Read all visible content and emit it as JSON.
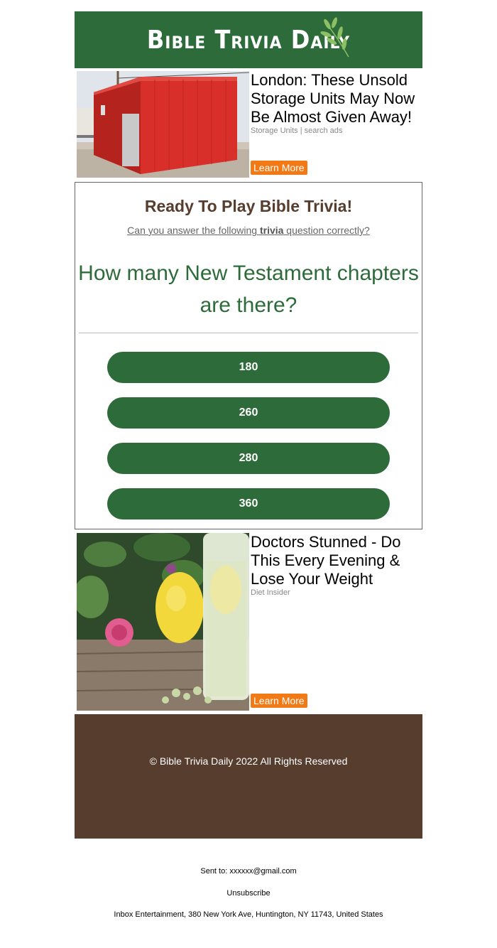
{
  "header": {
    "title": "Bible Trivia Daily",
    "bg_color": "#2e6b3a",
    "logo_icon": "leaf-icon"
  },
  "ad_top": {
    "title": "London: These Unsold Storage Units May Now Be Almost Given Away!",
    "source": "Storage Units | search ads",
    "cta": "Learn More",
    "image": "red-storage-container"
  },
  "quiz": {
    "heading": "Ready To Play Bible Trivia!",
    "sub_before": "Can you answer the following ",
    "sub_bold": "trivia",
    "sub_after": " question correctly?",
    "question": "How many New Testament chapters are there?",
    "answers": [
      "180",
      "260",
      "280",
      "360"
    ],
    "accent_color": "#2e6b3a",
    "heading_color": "#563d2d"
  },
  "ad_bottom": {
    "title": "Doctors Stunned - Do This Every Evening & Lose Your Weight",
    "source": "Diet Insider",
    "cta": "Learn More",
    "image": "lemon-water-rose"
  },
  "footer": {
    "copyright": "© Bible Trivia Daily 2022 All Rights Reserved",
    "bg_color": "#563d2d"
  },
  "meta": {
    "sent_to_label": "Sent to: ",
    "sent_to_email": "xxxxxx@gmail.com",
    "unsubscribe": "Unsubscribe",
    "address": "Inbox Entertainment, 380 New York Ave, Huntington, NY 11743, United States"
  },
  "cta_color": "#f27a16"
}
